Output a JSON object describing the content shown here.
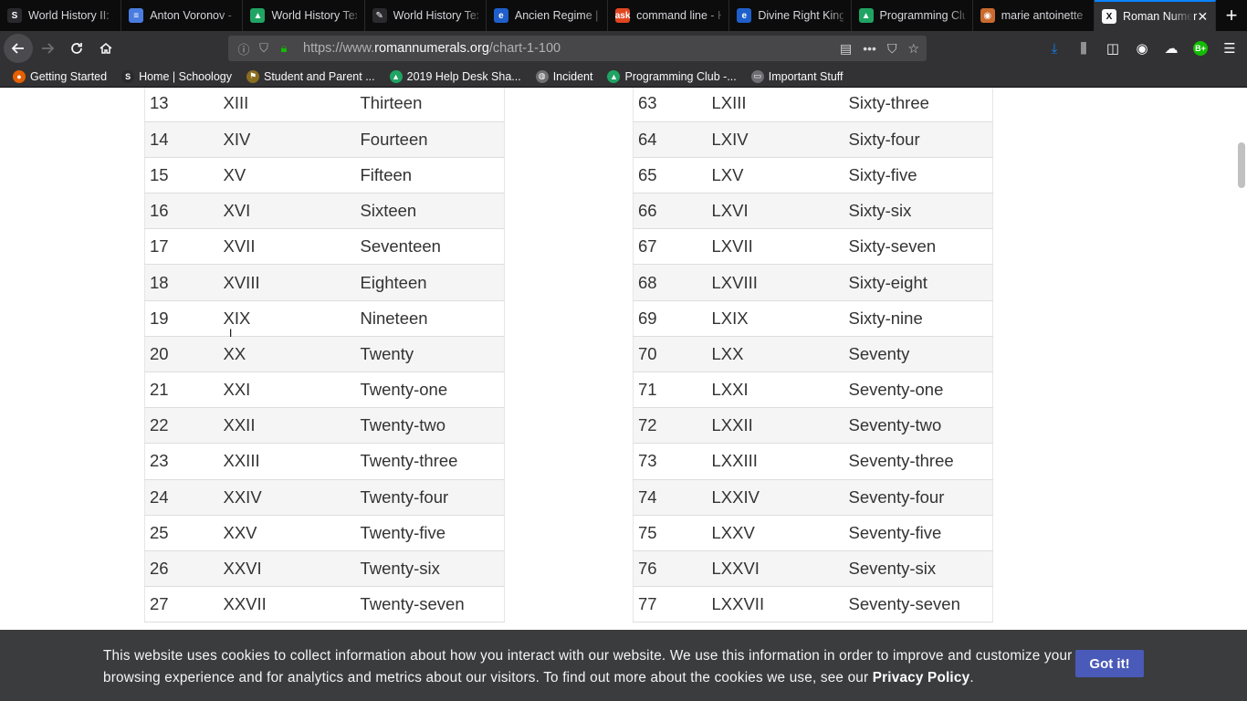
{
  "browser": {
    "tabs": [
      {
        "label": "World History II: S",
        "favicon": "schoology-icon",
        "color": "#2a2a2e",
        "glyph": "S"
      },
      {
        "label": "Anton Voronov - F",
        "favicon": "google-docs-icon",
        "color": "#4a7ce0",
        "glyph": "≡"
      },
      {
        "label": "World History Tex",
        "favicon": "google-drive-icon",
        "color": "#1fa463",
        "glyph": "▲"
      },
      {
        "label": "World History Tex",
        "favicon": "leaf-icon",
        "color": "#2a2a2e",
        "glyph": "✎"
      },
      {
        "label": "Ancien Regime | E",
        "favicon": "britannica-icon",
        "color": "#1f5fcc",
        "glyph": "e"
      },
      {
        "label": "command line - H",
        "favicon": "ask-icon",
        "color": "#e0461f",
        "glyph": "ask"
      },
      {
        "label": "Divine Right King",
        "favicon": "britannica-icon",
        "color": "#1f5fcc",
        "glyph": "e"
      },
      {
        "label": "Programming Clu",
        "favicon": "google-drive-icon",
        "color": "#1fa463",
        "glyph": "▲"
      },
      {
        "label": "marie antoinette",
        "favicon": "wiki-icon",
        "color": "#c96a2e",
        "glyph": "◉"
      },
      {
        "label": "Roman Numer",
        "favicon": "roman-x-icon",
        "color": "#f9f9fa",
        "glyph": "X",
        "active": true
      }
    ],
    "url": {
      "prefix": "https://www.",
      "domain": "romannumerals.org",
      "path": "/chart-1-100"
    },
    "bookmarks": [
      {
        "label": "Getting Started",
        "icon": "firefox-icon",
        "color": "#e66000",
        "glyph": "●"
      },
      {
        "label": "Home | Schoology",
        "icon": "schoology-icon",
        "color": "#2a2a2e",
        "glyph": "S"
      },
      {
        "label": "Student and Parent ...",
        "icon": "flag-icon",
        "color": "#8a6d1e",
        "glyph": "⚑"
      },
      {
        "label": "2019 Help Desk Sha...",
        "icon": "google-drive-icon",
        "color": "#1fa463",
        "glyph": "▲"
      },
      {
        "label": "Incident",
        "icon": "globe-icon",
        "color": "#6e6e73",
        "glyph": "◍"
      },
      {
        "label": "Programming Club -...",
        "icon": "google-drive-icon",
        "color": "#1fa463",
        "glyph": "▲"
      },
      {
        "label": "Important Stuff",
        "icon": "folder-icon",
        "color": "#6e6e73",
        "glyph": "▭"
      }
    ],
    "badge_text": "B+"
  },
  "tables": {
    "left": [
      [
        "13",
        "XIII",
        "Thirteen"
      ],
      [
        "14",
        "XIV",
        "Fourteen"
      ],
      [
        "15",
        "XV",
        "Fifteen"
      ],
      [
        "16",
        "XVI",
        "Sixteen"
      ],
      [
        "17",
        "XVII",
        "Seventeen"
      ],
      [
        "18",
        "XVIII",
        "Eighteen"
      ],
      [
        "19",
        "XIX",
        "Nineteen"
      ],
      [
        "20",
        "XX",
        "Twenty"
      ],
      [
        "21",
        "XXI",
        "Twenty-one"
      ],
      [
        "22",
        "XXII",
        "Twenty-two"
      ],
      [
        "23",
        "XXIII",
        "Twenty-three"
      ],
      [
        "24",
        "XXIV",
        "Twenty-four"
      ],
      [
        "25",
        "XXV",
        "Twenty-five"
      ],
      [
        "26",
        "XXVI",
        "Twenty-six"
      ],
      [
        "27",
        "XXVII",
        "Twenty-seven"
      ]
    ],
    "right": [
      [
        "63",
        "LXIII",
        "Sixty-three"
      ],
      [
        "64",
        "LXIV",
        "Sixty-four"
      ],
      [
        "65",
        "LXV",
        "Sixty-five"
      ],
      [
        "66",
        "LXVI",
        "Sixty-six"
      ],
      [
        "67",
        "LXVII",
        "Sixty-seven"
      ],
      [
        "68",
        "LXVIII",
        "Sixty-eight"
      ],
      [
        "69",
        "LXIX",
        "Sixty-nine"
      ],
      [
        "70",
        "LXX",
        "Seventy"
      ],
      [
        "71",
        "LXXI",
        "Seventy-one"
      ],
      [
        "72",
        "LXXII",
        "Seventy-two"
      ],
      [
        "73",
        "LXXIII",
        "Seventy-three"
      ],
      [
        "74",
        "LXXIV",
        "Seventy-four"
      ],
      [
        "75",
        "LXXV",
        "Seventy-five"
      ],
      [
        "76",
        "LXXVI",
        "Seventy-six"
      ],
      [
        "77",
        "LXXVII",
        "Seventy-seven"
      ]
    ]
  },
  "cookie": {
    "text": "This website uses cookies to collect information about how you interact with our website. We use this information in order to improve and customize your browsing experience and for analytics and metrics about our visitors. To find out more about the cookies we use, see our ",
    "link_label": "Privacy Policy",
    "end": ".",
    "button_label": "Got it!"
  }
}
